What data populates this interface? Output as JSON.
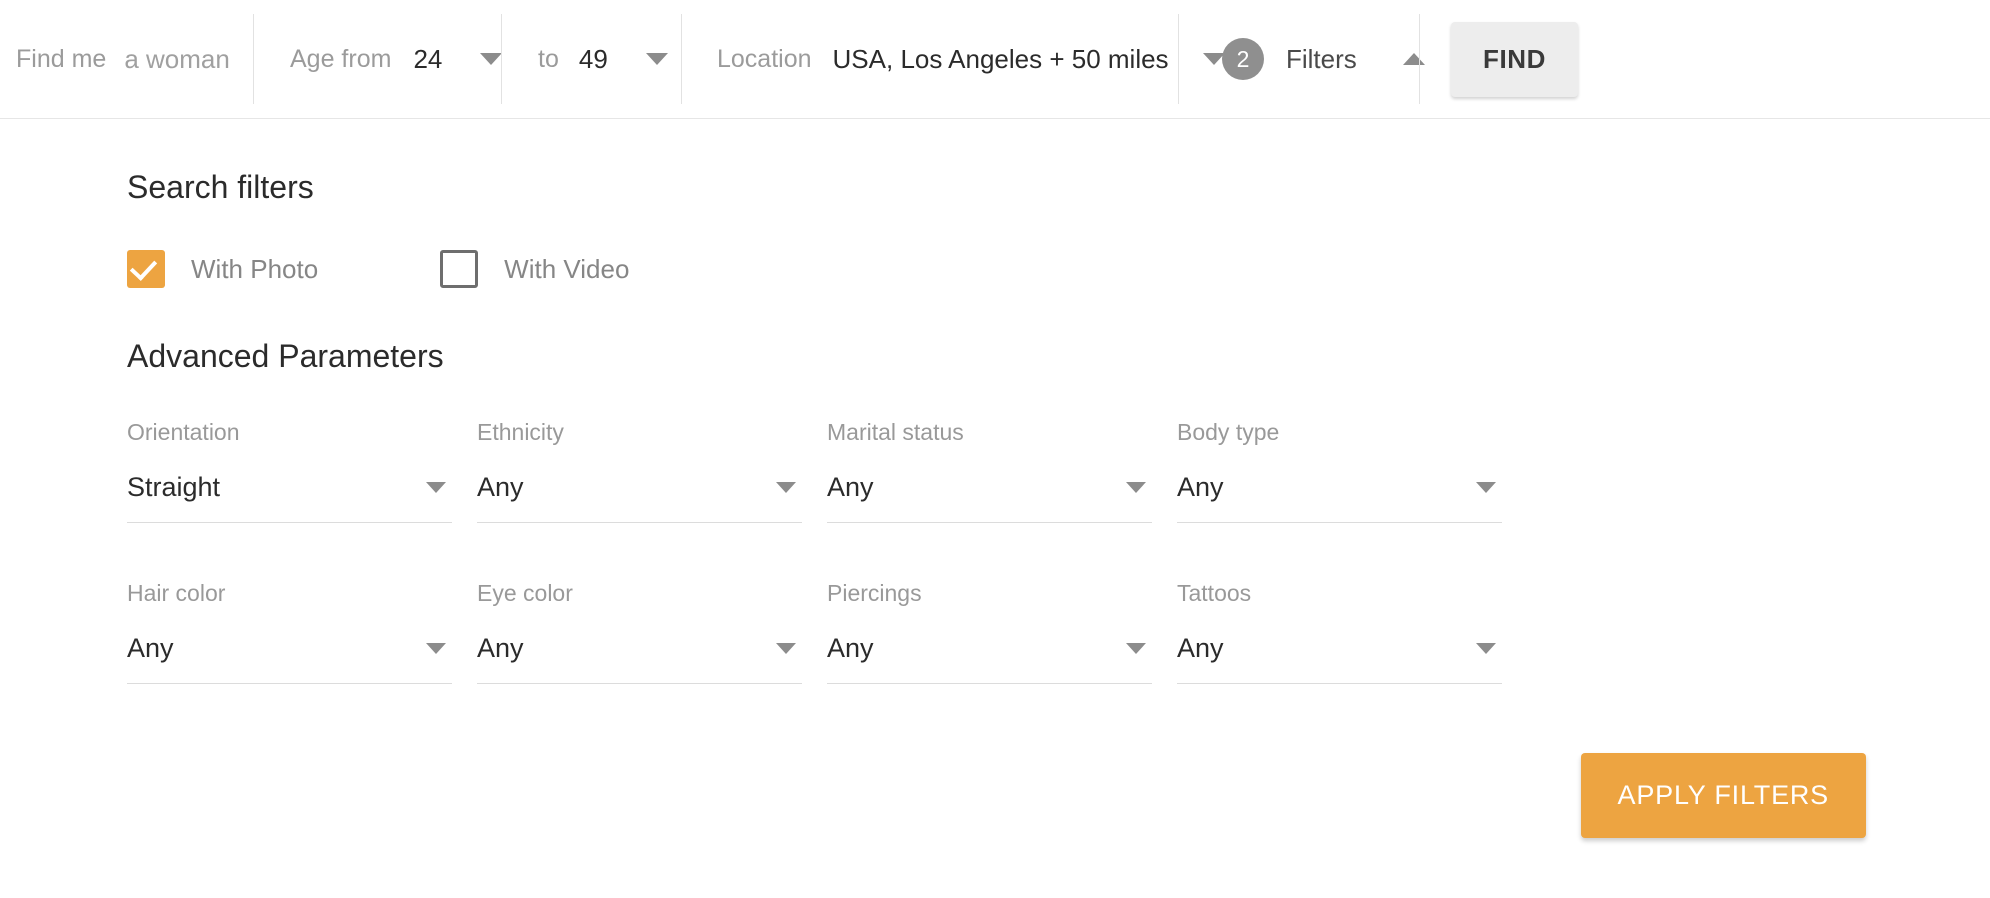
{
  "searchbar": {
    "find": {
      "label": "Find me",
      "value": "a woman"
    },
    "age_from": {
      "label": "Age from",
      "value": "24"
    },
    "age_to": {
      "label": "to",
      "value": "49"
    },
    "location": {
      "label": "Location",
      "value": "USA, Los Angeles + 50 miles"
    },
    "filters": {
      "badge_count": "2",
      "label": "Filters"
    },
    "find_button": "FIND"
  },
  "panel": {
    "search_filters_title": "Search filters",
    "checkboxes": [
      {
        "label": "With Photo",
        "checked": true
      },
      {
        "label": "With Video",
        "checked": false
      }
    ],
    "advanced_title": "Advanced Parameters",
    "fields": [
      {
        "label": "Orientation",
        "value": "Straight"
      },
      {
        "label": "Ethnicity",
        "value": "Any"
      },
      {
        "label": "Marital status",
        "value": "Any"
      },
      {
        "label": "Body type",
        "value": "Any"
      },
      {
        "label": "Hair color",
        "value": "Any"
      },
      {
        "label": "Eye color",
        "value": "Any"
      },
      {
        "label": "Piercings",
        "value": "Any"
      },
      {
        "label": "Tattoos",
        "value": "Any"
      }
    ],
    "apply_button": "APPLY FILTERS"
  },
  "colors": {
    "accent_orange": "#eda441",
    "badge_gray": "#8f8f8f",
    "find_button_bg": "#ededed",
    "label_gray": "#999999",
    "divider": "#e2e2e2"
  }
}
